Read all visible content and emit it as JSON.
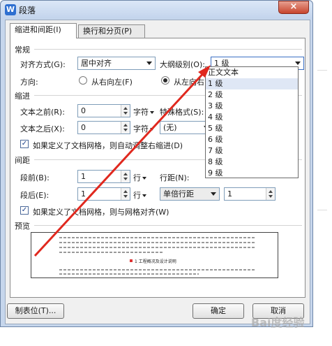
{
  "window": {
    "title": "段落",
    "app_icon": "W",
    "close_label": "×"
  },
  "tabs": [
    {
      "label": "缩进和间距(I)",
      "active": true
    },
    {
      "label": "换行和分页(P)",
      "active": false
    }
  ],
  "general": {
    "section_label": "常规",
    "align_label": "对齐方式(G):",
    "align_value": "居中对齐",
    "outline_label": "大纲级别(O):",
    "outline_value": "1 级",
    "direction_label": "方向:",
    "rtl_label": "从右向左(F)",
    "ltr_label": "从左向右"
  },
  "indent": {
    "section_label": "缩进",
    "before_label": "文本之前(R):",
    "before_value": "0",
    "before_unit": "字符",
    "after_label": "文本之后(X):",
    "after_value": "0",
    "after_unit": "字符",
    "special_label": "特殊格式(S):",
    "special_value": "(无)",
    "grid_check_label": "如果定义了文档网格，则自动调整右缩进(D)"
  },
  "spacing": {
    "section_label": "间距",
    "before_label": "段前(B):",
    "before_value": "1",
    "before_unit": "行",
    "after_label": "段后(E):",
    "after_value": "1",
    "after_unit": "行",
    "line_label": "行距(N):",
    "line_value": "单倍行距",
    "at_value": "1",
    "grid_check_label": "如果定义了文档网格，则与网格对齐(W)"
  },
  "preview": {
    "section_label": "预览",
    "sample_text": "1 工程概况及设计说明"
  },
  "outline_dropdown": {
    "options": [
      "正文文本",
      "1 级",
      "2 级",
      "3 级",
      "4 级",
      "5 级",
      "6 级",
      "7 级",
      "8 级",
      "9 级"
    ],
    "highlighted": "1 级"
  },
  "buttons": {
    "tabs_label": "制表位(T)...",
    "ok_label": "确定",
    "cancel_label": "取消"
  },
  "watermark": "Bai度经验",
  "colors": {
    "arrow": "#e0281e",
    "title_bar": "#c3d4ec",
    "close": "#c7452e"
  }
}
